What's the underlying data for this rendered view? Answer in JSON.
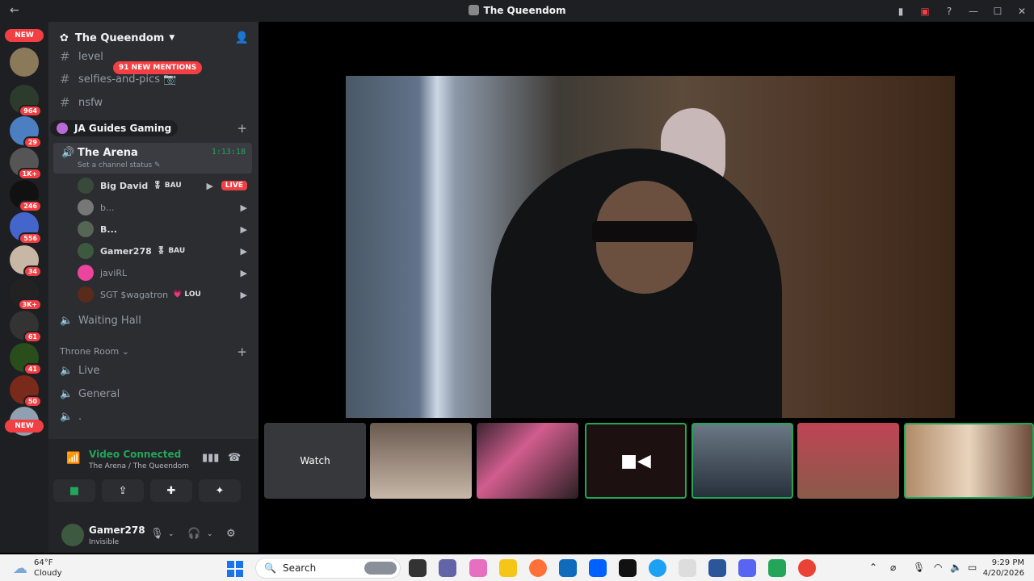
{
  "window": {
    "title": "The Queendom",
    "back_icon": "arrow-left-icon"
  },
  "guilds": {
    "new_top": "NEW",
    "new_bottom": "NEW",
    "badges": [
      "964",
      "29",
      "1K+",
      "246",
      "556",
      "34",
      "3K+",
      "61",
      "41",
      "50"
    ]
  },
  "server": {
    "name": "The Queendom"
  },
  "channels": {
    "level": "level",
    "selfies": "selfies-and-pics 📷",
    "nsfw": "nsfw",
    "mentions": "91 NEW MENTIONS"
  },
  "category": {
    "name": "JA Guides Gaming"
  },
  "arena": {
    "name": "The Arena",
    "timer": "1:13:18",
    "status": "Set a channel status ✎"
  },
  "voice_users": [
    {
      "name": "Big David",
      "tag": "🎖 BAU",
      "live": "LIVE"
    },
    {
      "name": "b...",
      "tag": ""
    },
    {
      "name": "B...",
      "tag": ""
    },
    {
      "name": "Gamer278",
      "tag": "🎖 BAU"
    },
    {
      "name": "javiRL",
      "tag": ""
    },
    {
      "name": "SGT $wagatron",
      "tag": "💗 LOU"
    }
  ],
  "waiting_hall": "Waiting Hall",
  "throne": {
    "category": "Throne Room ⌄",
    "live": "Live",
    "general": "General",
    "dot": "."
  },
  "voice": {
    "title": "Video Connected",
    "sub": "The Arena / The Queendom"
  },
  "me": {
    "name": "Gamer278",
    "status": "Invisible"
  },
  "stage": {
    "watch": "Watch"
  },
  "taskbar": {
    "temp": "64°F",
    "condition": "Cloudy",
    "search": "Search",
    "time": "9:29 PM",
    "date": "4/20/2026"
  }
}
